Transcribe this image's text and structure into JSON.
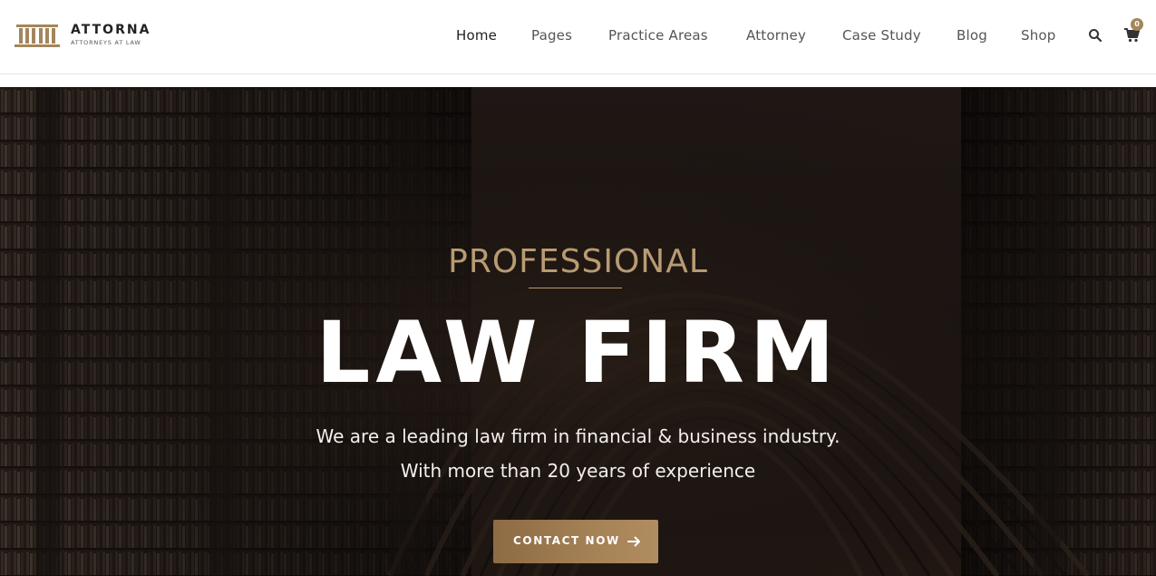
{
  "header": {
    "logo": {
      "name": "ATTORNA",
      "tagline": "ATTORNEYS AT LAW",
      "icon": "courthouse-columns-icon"
    },
    "nav": [
      {
        "label": "Home",
        "active": true
      },
      {
        "label": "Pages",
        "active": false
      },
      {
        "label": "Practice Areas",
        "active": false
      },
      {
        "label": "Attorney",
        "active": false
      },
      {
        "label": "Case Study",
        "active": false
      },
      {
        "label": "Blog",
        "active": false
      },
      {
        "label": "Shop",
        "active": false
      }
    ],
    "search_icon": "search-icon",
    "cart": {
      "icon": "cart-icon",
      "count": "0"
    }
  },
  "hero": {
    "eyebrow": "PROFESSIONAL",
    "title": "LAW FIRM",
    "line1": "We are a leading law firm in financial & business industry.",
    "line2": "With more than 20 years of experience",
    "cta_label": "CONTACT NOW",
    "cta_icon": "arrow-right-icon",
    "background": "library-bookshelves-arch-image"
  },
  "colors": {
    "accent_gold": "#b89b72",
    "button_gold": "#a58156",
    "text_dark": "#222222",
    "nav_text": "#555555"
  }
}
